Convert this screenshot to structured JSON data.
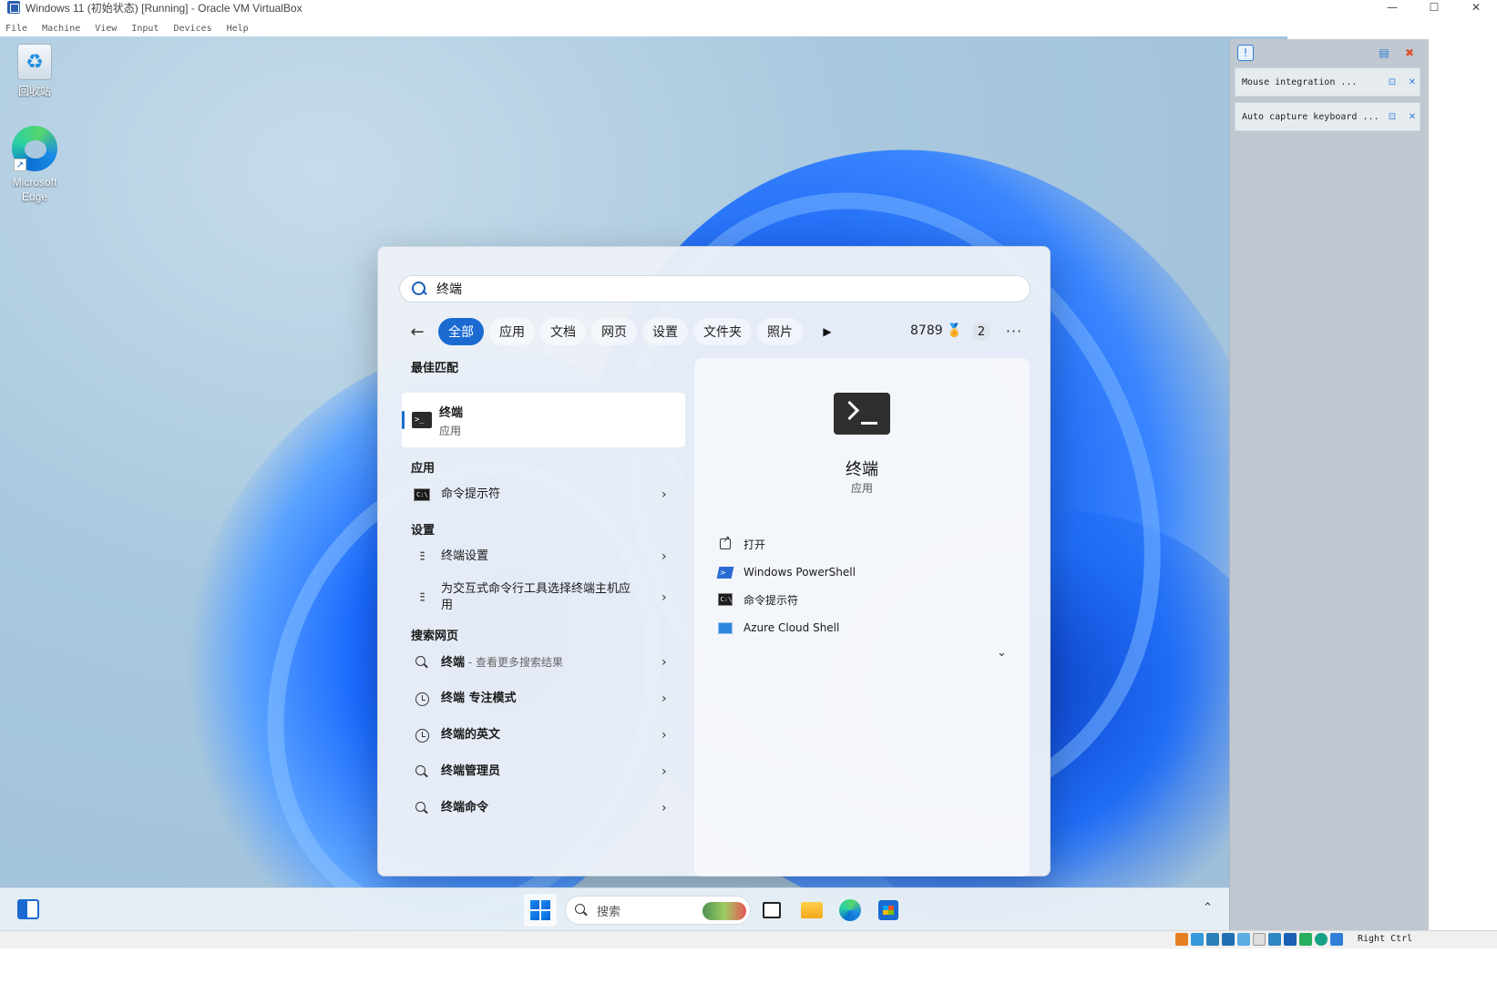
{
  "window": {
    "title": "Windows 11 (初始状态) [Running] - Oracle VM VirtualBox",
    "controls": {
      "minimize": "—",
      "maximize": "☐",
      "close": "✕"
    }
  },
  "menubar": {
    "items": [
      {
        "label": "File"
      },
      {
        "label": "Machine"
      },
      {
        "label": "View"
      },
      {
        "label": "Input"
      },
      {
        "label": "Devices"
      },
      {
        "label": "Help"
      }
    ]
  },
  "desktop": {
    "icons": [
      {
        "label": "回收站",
        "icon": "recycle-bin-icon"
      },
      {
        "label": "Microsoft Edge",
        "icon": "edge-icon"
      }
    ]
  },
  "search": {
    "query": "终端",
    "tabs": [
      {
        "label": "全部",
        "active": true
      },
      {
        "label": "应用"
      },
      {
        "label": "文档"
      },
      {
        "label": "网页"
      },
      {
        "label": "设置"
      },
      {
        "label": "文件夹"
      },
      {
        "label": "照片"
      }
    ],
    "more_tabs_glyph": "▶",
    "points": "8789",
    "badge_count": "2",
    "more_glyph": "···",
    "best_match": {
      "heading": "最佳匹配",
      "title": "终端",
      "subtitle": "应用"
    },
    "apps": {
      "heading": "应用",
      "items": [
        {
          "label": "命令提示符"
        }
      ]
    },
    "settings": {
      "heading": "设置",
      "items": [
        {
          "label": "终端设置"
        },
        {
          "label": "为交互式命令行工具选择终端主机应用"
        }
      ]
    },
    "web": {
      "heading": "搜索网页",
      "items": [
        {
          "label": "终端",
          "suffix": " - 查看更多搜索结果",
          "icon": "search-icon"
        },
        {
          "label": "终端 专注模式",
          "icon": "history-icon"
        },
        {
          "label": "终端的英文",
          "icon": "history-icon"
        },
        {
          "label": "终端管理员",
          "icon": "search-icon"
        },
        {
          "label": "终端命令",
          "icon": "search-icon"
        }
      ]
    },
    "detail": {
      "title": "终端",
      "subtitle": "应用",
      "actions": [
        {
          "label": "打开",
          "icon": "open-icon"
        },
        {
          "label": "Windows PowerShell",
          "icon": "powershell-icon"
        },
        {
          "label": "命令提示符",
          "icon": "cmd-icon"
        },
        {
          "label": "Azure Cloud Shell",
          "icon": "azure-icon"
        }
      ]
    }
  },
  "vbox_notifications": {
    "items": [
      {
        "text": "Mouse integration ..."
      },
      {
        "text": "Auto capture keyboard ..."
      }
    ]
  },
  "taskbar": {
    "search_placeholder": "搜索"
  },
  "statusbar": {
    "host_key": "Right Ctrl"
  },
  "colors": {
    "accent": "#1a6ad2",
    "desktop_bg": "#a9c8de",
    "panel_bg": "#ecf1f7",
    "vbox_side": "#bfc8d1"
  }
}
